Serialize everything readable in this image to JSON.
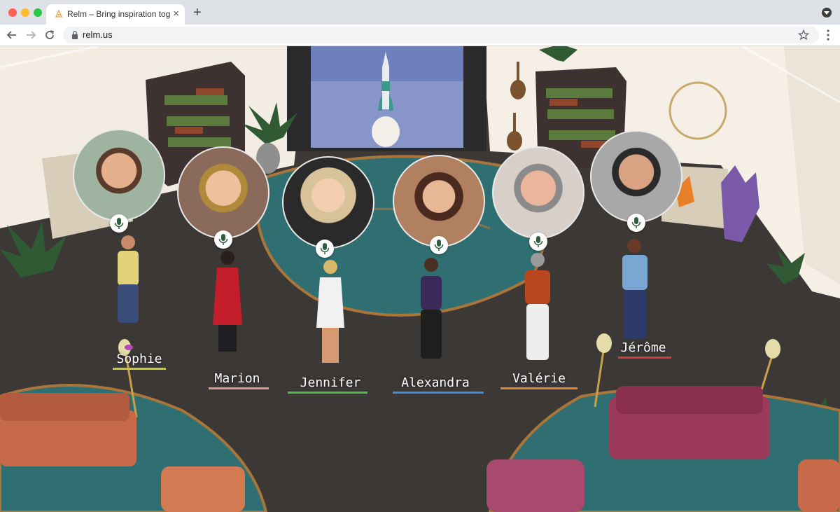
{
  "browser": {
    "tab_title": "Relm – Bring inspiration together",
    "tab_close": "×",
    "new_tab": "+",
    "url": "relm.us"
  },
  "participants": [
    {
      "name": "Sophie",
      "color": "#c9c83c"
    },
    {
      "name": "Marion",
      "color": "#d89a8a"
    },
    {
      "name": "Jennifer",
      "color": "#4fb84f"
    },
    {
      "name": "Alexandra",
      "color": "#3f8fd6"
    },
    {
      "name": "Valérie",
      "color": "#e0883a"
    },
    {
      "name": "Jérôme",
      "color": "#d9363e"
    }
  ],
  "icons": {
    "back": "arrow-left-icon",
    "forward": "arrow-right-icon",
    "reload": "reload-icon",
    "lock": "lock-icon",
    "bookmark": "star-icon",
    "menu": "kebab-menu-icon",
    "mic": "microphone-icon"
  }
}
